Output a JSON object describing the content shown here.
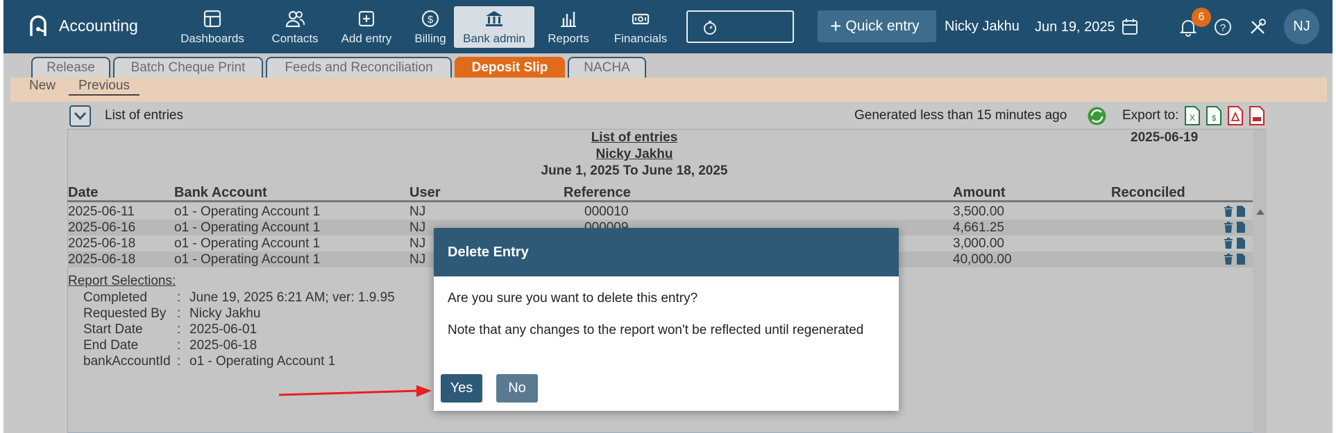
{
  "app": {
    "name": "Accounting"
  },
  "nav": {
    "items": [
      {
        "label": "Dashboards",
        "icon": "dashboard-icon"
      },
      {
        "label": "Contacts",
        "icon": "contacts-icon"
      },
      {
        "label": "Add entry",
        "icon": "add-entry-icon"
      },
      {
        "label": "Billing",
        "icon": "billing-dollar-icon"
      },
      {
        "label": "Bank admin",
        "icon": "bank-icon",
        "active": true
      },
      {
        "label": "Reports",
        "icon": "reports-chart-icon"
      },
      {
        "label": "Financials",
        "icon": "financials-cash-icon"
      }
    ],
    "timer_icon": "stopwatch-icon",
    "quick_entry": "Quick entry",
    "user_name": "Nicky Jakhu",
    "date": "Jun 19, 2025",
    "notification_count": "6",
    "avatar_initials": "NJ"
  },
  "tabs": [
    {
      "label": "Release"
    },
    {
      "label": "Batch Cheque Print"
    },
    {
      "label": "Feeds and Reconciliation"
    },
    {
      "label": "Deposit Slip",
      "active": true
    },
    {
      "label": "NACHA"
    }
  ],
  "subtabs": {
    "new": "New",
    "previous": "Previous"
  },
  "toolbar": {
    "list_title": "List of entries",
    "generated": "Generated less than 15 minutes ago",
    "export_label": "Export to:",
    "export_icons": [
      "excel-icon",
      "csv-icon",
      "pdf-icon",
      "pdf-alt-icon"
    ]
  },
  "report": {
    "title": "List of entries",
    "subtitle": "Nicky Jakhu",
    "period": "June 1, 2025 To June 18, 2025",
    "date": "2025-06-19",
    "columns": {
      "date": "Date",
      "bank_account": "Bank Account",
      "user": "User",
      "reference": "Reference",
      "amount": "Amount",
      "reconciled": "Reconciled"
    },
    "rows": [
      {
        "date": "2025-06-11",
        "bank_account": "o1 - Operating Account 1",
        "user": "NJ",
        "reference": "000010",
        "amount": "3,500.00"
      },
      {
        "date": "2025-06-16",
        "bank_account": "o1 - Operating Account 1",
        "user": "NJ",
        "reference": "000009",
        "amount": "4,661.25"
      },
      {
        "date": "2025-06-18",
        "bank_account": "o1 - Operating Account 1",
        "user": "NJ",
        "reference": "",
        "amount": "3,000.00"
      },
      {
        "date": "2025-06-18",
        "bank_account": "o1 - Operating Account 1",
        "user": "NJ",
        "reference": "",
        "amount": "40,000.00"
      }
    ],
    "selections": {
      "heading": "Report Selections:",
      "items": [
        {
          "key": "Completed",
          "value": "June 19, 2025 6:21 AM; ver: 1.9.95"
        },
        {
          "key": "Requested By",
          "value": "Nicky Jakhu"
        },
        {
          "key": "Start Date",
          "value": "2025-06-01"
        },
        {
          "key": "End Date",
          "value": "2025-06-18"
        },
        {
          "key": "bankAccountId",
          "value": "o1 - Operating Account 1"
        }
      ]
    }
  },
  "modal": {
    "title": "Delete Entry",
    "question": "Are you sure you want to delete this entry?",
    "note": "Note that any changes to the report won't be reflected until regenerated",
    "yes": "Yes",
    "no": "No"
  },
  "colors": {
    "nav_bg": "#1f4e6e",
    "accent_orange": "#e06b1a",
    "modal_header": "#2e5a78",
    "subbar": "#e9cfb7",
    "annotation_arrow": "#e82020"
  }
}
